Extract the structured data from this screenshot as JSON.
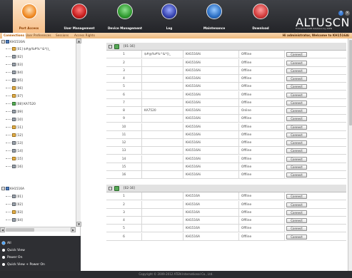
{
  "header": {
    "nav": [
      {
        "label": "Port Access",
        "icon": "port-access-icon",
        "active": true
      },
      {
        "label": "User Management",
        "icon": "user-management-icon",
        "active": false
      },
      {
        "label": "Device Management",
        "icon": "device-management-icon",
        "active": false
      },
      {
        "label": "Log",
        "icon": "log-icon",
        "active": false
      },
      {
        "label": "Maintenance",
        "icon": "maintenance-icon",
        "active": false
      },
      {
        "label": "Download",
        "icon": "download-icon",
        "active": false
      }
    ],
    "brand": "ALTUSCN",
    "brand_tag": "Enterprise KVM Solutions by ATEN",
    "help_icon": "?",
    "logout_icon": "×"
  },
  "subnav": {
    "tabs": [
      "Connections",
      "User Preferences",
      "Sessions",
      "Access Rights"
    ],
    "active_tab": "Connections",
    "welcome": "Hi administrator, Welcome to KH1516Ai"
  },
  "sidebar": {
    "tree": [
      {
        "label": "KH1516Ai",
        "kind": "root",
        "expanded": true
      },
      {
        "label": "[01] $#@%#%^&*()_",
        "kind": "port-warn"
      },
      {
        "label": "[02]",
        "kind": "port"
      },
      {
        "label": "[03]",
        "kind": "port"
      },
      {
        "label": "[04]",
        "kind": "port"
      },
      {
        "label": "[05]",
        "kind": "port"
      },
      {
        "label": "[06]",
        "kind": "port-warn"
      },
      {
        "label": "[07]",
        "kind": "port-warn"
      },
      {
        "label": "[08] KA7520",
        "kind": "port-on"
      },
      {
        "label": "[09]",
        "kind": "port"
      },
      {
        "label": "[10]",
        "kind": "port"
      },
      {
        "label": "[11]",
        "kind": "port-warn"
      },
      {
        "label": "[12]",
        "kind": "port-warn"
      },
      {
        "label": "[13]",
        "kind": "port"
      },
      {
        "label": "[14]",
        "kind": "port"
      },
      {
        "label": "[15]",
        "kind": "port-warn"
      },
      {
        "label": "[16]",
        "kind": "port"
      },
      {
        "label": "KH1516A",
        "kind": "root",
        "expanded": true
      },
      {
        "label": "[01]",
        "kind": "port"
      },
      {
        "label": "[02]",
        "kind": "port"
      },
      {
        "label": "[03]",
        "kind": "port-warn"
      },
      {
        "label": "[04]",
        "kind": "port"
      }
    ],
    "view_options": [
      {
        "label": "All",
        "selected": true
      },
      {
        "label": "Quick View",
        "selected": false
      },
      {
        "label": "Power On",
        "selected": false
      },
      {
        "label": "Quick View + Power On",
        "selected": false
      }
    ]
  },
  "main": {
    "groups": [
      {
        "label": "[01-16]",
        "rows": [
          {
            "num": "1",
            "name": "$#@%#%^&*()_",
            "device": "KH1516Ai",
            "status": "Offline",
            "action": "Connect"
          },
          {
            "num": "2",
            "name": "",
            "device": "KH1516Ai",
            "status": "Offline",
            "action": "Connect"
          },
          {
            "num": "3",
            "name": "",
            "device": "KH1516Ai",
            "status": "Offline",
            "action": "Connect"
          },
          {
            "num": "4",
            "name": "",
            "device": "KH1516Ai",
            "status": "Offline",
            "action": "Connect"
          },
          {
            "num": "5",
            "name": "",
            "device": "KH1516Ai",
            "status": "Offline",
            "action": "Connect"
          },
          {
            "num": "6",
            "name": "",
            "device": "KH1516Ai",
            "status": "Offline",
            "action": "Connect"
          },
          {
            "num": "7",
            "name": "",
            "device": "KH1516Ai",
            "status": "Offline",
            "action": "Connect"
          },
          {
            "num": "8",
            "name": "KA7520",
            "device": "KH1516Ai",
            "status": "Online",
            "action": "Connect"
          },
          {
            "num": "9",
            "name": "",
            "device": "KH1516Ai",
            "status": "Offline",
            "action": "Connect"
          },
          {
            "num": "10",
            "name": "",
            "device": "KH1516Ai",
            "status": "Offline",
            "action": "Connect"
          },
          {
            "num": "11",
            "name": "",
            "device": "KH1516Ai",
            "status": "Offline",
            "action": "Connect"
          },
          {
            "num": "12",
            "name": "",
            "device": "KH1516Ai",
            "status": "Offline",
            "action": "Connect"
          },
          {
            "num": "13",
            "name": "",
            "device": "KH1516Ai",
            "status": "Offline",
            "action": "Connect"
          },
          {
            "num": "14",
            "name": "",
            "device": "KH1516Ai",
            "status": "Offline",
            "action": "Connect"
          },
          {
            "num": "15",
            "name": "",
            "device": "KH1516Ai",
            "status": "Offline",
            "action": "Connect"
          },
          {
            "num": "16",
            "name": "",
            "device": "KH1516Ai",
            "status": "Offline",
            "action": "Connect"
          }
        ]
      },
      {
        "label": "[02-16]",
        "rows": [
          {
            "num": "1",
            "name": "",
            "device": "KH1516A",
            "status": "Offline",
            "action": "Connect"
          },
          {
            "num": "2",
            "name": "",
            "device": "KH1516A",
            "status": "Offline",
            "action": "Connect"
          },
          {
            "num": "3",
            "name": "",
            "device": "KH1516A",
            "status": "Offline",
            "action": "Connect"
          },
          {
            "num": "4",
            "name": "",
            "device": "KH1516A",
            "status": "Offline",
            "action": "Connect"
          },
          {
            "num": "5",
            "name": "",
            "device": "KH1516A",
            "status": "Offline",
            "action": "Connect"
          },
          {
            "num": "6",
            "name": "",
            "device": "KH1516A",
            "status": "Offline",
            "action": "Connect"
          }
        ]
      }
    ]
  },
  "footer": {
    "copyright": "Copyright © 2009-2012 ATEN International Co., Ltd."
  },
  "colors": {
    "accent": "#f08a24",
    "header_bg": "#2f3035",
    "subnav_bg": "#f3c894"
  }
}
